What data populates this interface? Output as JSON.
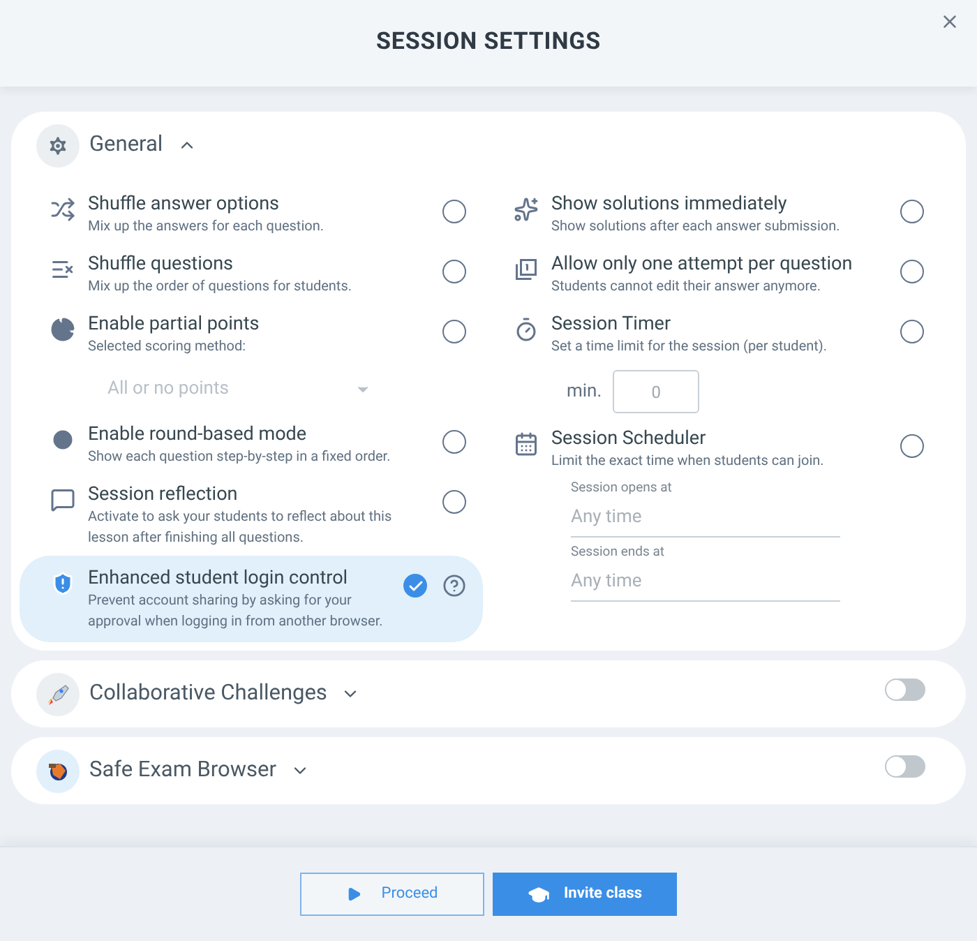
{
  "dialog": {
    "title": "SESSION SETTINGS"
  },
  "sections": [
    {
      "title": "General",
      "expanded": true,
      "left": [
        {
          "kind": "option",
          "title": "Shuffle answer options",
          "description": "Mix up the answers for each question.",
          "checked": false
        },
        {
          "kind": "option",
          "title": "Shuffle questions",
          "description": "Mix up the order of questions for students.",
          "checked": false
        },
        {
          "kind": "option",
          "title": "Enable partial points",
          "description": "Selected scoring method:",
          "checked": false
        },
        {
          "kind": "select",
          "value": "All or no points",
          "disabled": true
        },
        {
          "kind": "option",
          "title": "Enable round-based mode",
          "description": "Show each question step-by-step in a fixed order.",
          "checked": false
        },
        {
          "kind": "option",
          "title": "Session reflection",
          "description": "Activate to ask your students to reflect about this lesson after finishing all questions.",
          "checked": false
        },
        {
          "kind": "option",
          "title": "Enhanced student login control",
          "description": "Prevent account sharing by asking for your approval when logging in from another browser.",
          "checked": true,
          "help": true
        }
      ],
      "right": [
        {
          "kind": "option",
          "title": "Show solutions immediately",
          "description": "Show solutions after each answer submission.",
          "checked": false
        },
        {
          "kind": "option",
          "title": "Allow only one attempt per question",
          "description": "Students cannot edit their answer anymore.",
          "checked": false
        },
        {
          "kind": "option",
          "title": "Session Timer",
          "description": "Set a time limit for the session (per student).",
          "checked": false
        },
        {
          "kind": "number",
          "label": "min.",
          "value": "0"
        },
        {
          "kind": "option",
          "title": "Session Scheduler",
          "description": "Limit the exact time when students can join.",
          "checked": false
        },
        {
          "kind": "datetime",
          "label": "Session opens at",
          "placeholder": "Any time"
        },
        {
          "kind": "datetime",
          "label": "Session ends at",
          "placeholder": "Any time"
        }
      ]
    },
    {
      "title": "Collaborative Challenges",
      "expanded": false,
      "on": false
    },
    {
      "title": "Safe Exam Browser",
      "expanded": false,
      "on": false
    }
  ],
  "buttons": [
    {
      "label": "Proceed",
      "kind": "secondary"
    },
    {
      "label": "Invite class",
      "kind": "primary"
    }
  ]
}
